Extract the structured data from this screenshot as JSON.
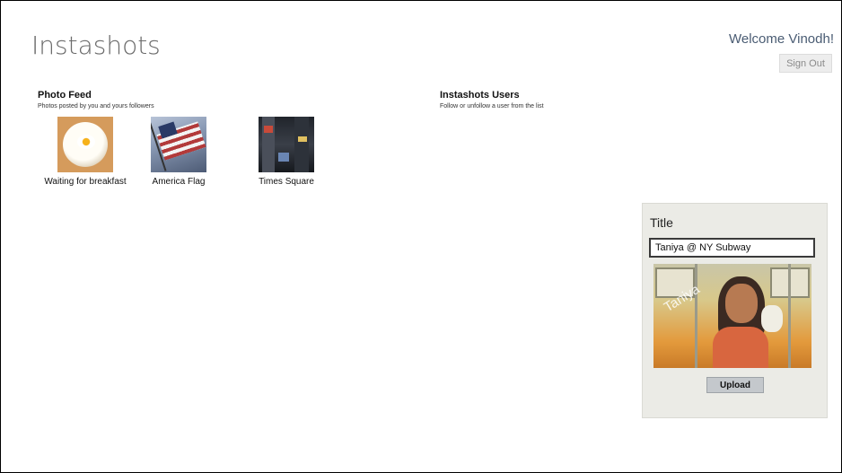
{
  "app": {
    "title": "Instashots"
  },
  "header": {
    "welcome": "Welcome Vinodh!",
    "sign_out": "Sign Out"
  },
  "photo_feed": {
    "title": "Photo Feed",
    "subtitle": "Photos posted by you and yours followers",
    "items": [
      {
        "caption": "Waiting for breakfast",
        "icon": "breakfast-photo"
      },
      {
        "caption": "America Flag",
        "icon": "flag-photo"
      },
      {
        "caption": "Times Square",
        "icon": "times-square-photo"
      }
    ]
  },
  "users": {
    "title": "Instashots Users",
    "subtitle": "Follow or unfollow a user from the list"
  },
  "upload": {
    "label": "Title",
    "title_value": "Taniya @ NY Subway",
    "preview_watermark": "Taniya",
    "button": "Upload"
  },
  "colors": {
    "title_gray": "#6b6b6b",
    "welcome_blue": "#4a5c73",
    "panel_bg": "#ebebe6",
    "button_gray": "#c4c8cc"
  }
}
